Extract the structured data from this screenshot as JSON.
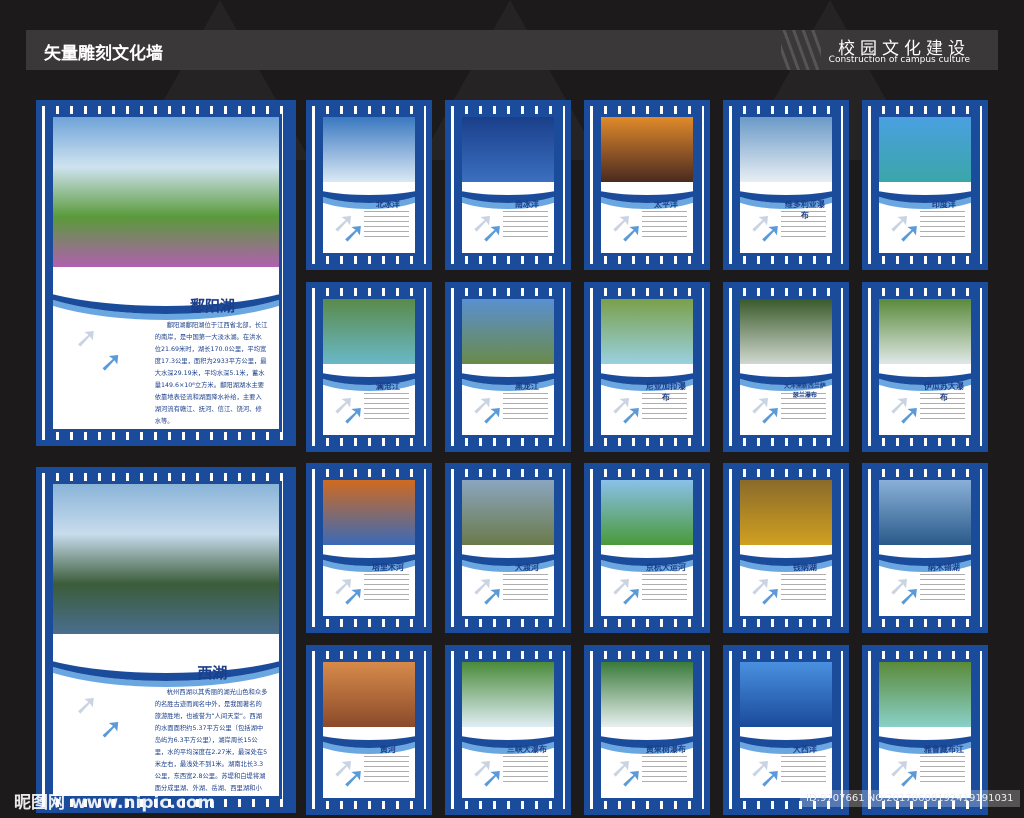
{
  "header": {
    "title": "矢量雕刻文化墙",
    "subtitle_cn": "校园文化建设",
    "subtitle_en": "Construction of campus culture"
  },
  "large_panels": [
    {
      "title": "鄱阳湖",
      "body": "鄱阳湖鄱阳湖位于江西省北部，长江的南岸，是中国第一大淡水湖。在洪水位21.69米时，湖长170.0公里，平均宽度17.3公里，面积为2933平方公里，最大水深29.19米，平均水深5.1米，蓄水量149.6×10⁸立方米。鄱阳湖湖水主要依靠地表径流和湖面降水补给，主要入湖河流有赣江、抚河、信江、饶河、修水等。",
      "colors": [
        "#6fa3d8",
        "#cfe3f0",
        "#5a9a3a",
        "#b060b0"
      ]
    },
    {
      "title": "西湖",
      "body": "杭州西湖以其秀丽的湖光山色和众多的名胜古迹而闻名中外，是我国著名的旅游胜地，也被誉为“人间天堂”。西湖的水面面积约5.37平方公里（包括湖中岛屿为6.3平方公里），湖岸周长15公里，水的平均深度在2.27米，最深处在5米左右，最浅处不到1米。湖南北长3.3公里，东西宽2.8公里。苏堤和白堤将湖面分成里湖、外湖、岳湖、西里湖和小南湖五个部分。",
      "colors": [
        "#8ab4d8",
        "#c8dced",
        "#3b5c3a",
        "#4a6e8e"
      ]
    }
  ],
  "small_panels": [
    {
      "title": "北冰洋",
      "colors": [
        "#3a78c0",
        "#dbe9f5"
      ]
    },
    {
      "title": "南冰洋",
      "colors": [
        "#1a3f8a",
        "#3b6fc0"
      ]
    },
    {
      "title": "太平洋",
      "colors": [
        "#e08a2a",
        "#4a2a20"
      ]
    },
    {
      "title": "维多利亚瀑布",
      "colors": [
        "#6a9ac8",
        "#e8eef3"
      ]
    },
    {
      "title": "印度洋",
      "colors": [
        "#4aa0e0",
        "#3aa6a8"
      ]
    },
    {
      "title": "澜沧江",
      "colors": [
        "#5a8a4a",
        "#6ab8c8"
      ]
    },
    {
      "title": "黑龙江",
      "colors": [
        "#5a90d0",
        "#6a8a4a"
      ]
    },
    {
      "title": "尼亚加拉瀑布",
      "colors": [
        "#7aa04a",
        "#9ad0e0"
      ]
    },
    {
      "title": "大洋洲新西兰萨瑟兰瀑布",
      "colors": [
        "#3a5a2a",
        "#d0d8d0"
      ]
    },
    {
      "title": "伊瓜苏大瀑布",
      "colors": [
        "#5a8a3a",
        "#e0e8e8"
      ]
    },
    {
      "title": "塔里木河",
      "colors": [
        "#d06a20",
        "#3a6ab8"
      ]
    },
    {
      "title": "大渡河",
      "colors": [
        "#8aa6c0",
        "#6a7a4a"
      ]
    },
    {
      "title": "京杭大运河",
      "colors": [
        "#8ac0e8",
        "#4a9a3a"
      ]
    },
    {
      "title": "钱纳湖",
      "colors": [
        "#8a6a2a",
        "#d0a020"
      ]
    },
    {
      "title": "纳木错湖",
      "colors": [
        "#8ab0d8",
        "#2a5a8a"
      ]
    },
    {
      "title": "黄河",
      "colors": [
        "#d88a4a",
        "#8a4a2a"
      ]
    },
    {
      "title": "三峡大瀑布",
      "colors": [
        "#4a8a3a",
        "#e0eef5"
      ]
    },
    {
      "title": "黄果树瀑布",
      "colors": [
        "#3a7a3a",
        "#e8f0f0"
      ]
    },
    {
      "title": "大西洋",
      "colors": [
        "#4a90e0",
        "#1a4a9a"
      ]
    },
    {
      "title": "雅鲁藏布江",
      "colors": [
        "#5a8a3a",
        "#8ad0c8"
      ]
    }
  ],
  "watermark": {
    "site": "昵图网 www.nipic.com",
    "id": "ID:9707661 NO:20170608192419191031"
  },
  "colors": {
    "frame_blue": "#1b4c9c",
    "background": "#1c1a1a"
  }
}
